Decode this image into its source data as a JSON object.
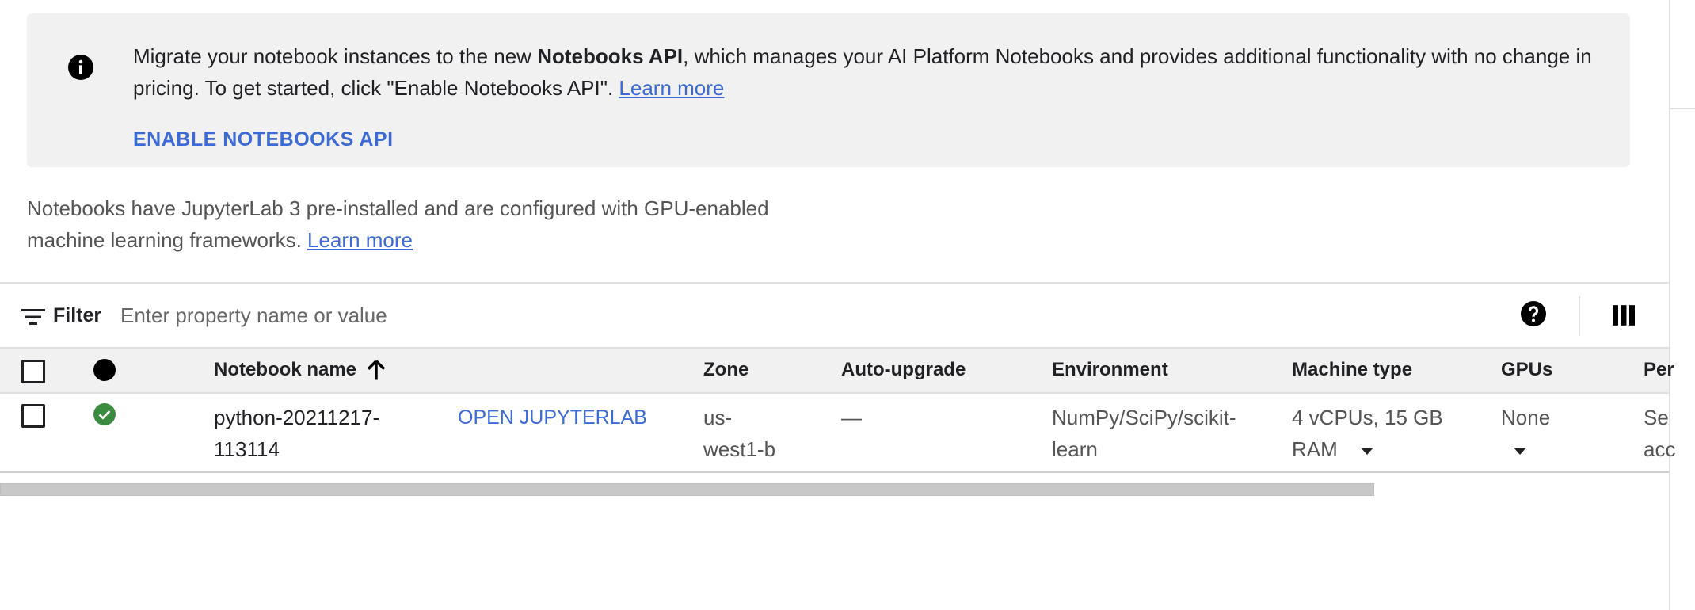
{
  "banner": {
    "message_part1": "Migrate your notebook instances to the new ",
    "message_bold": "Notebooks API",
    "message_part2": ", which manages your AI Platform Notebooks and provides additional functionality with no change in pricing. To get started, click \"Enable Notebooks API\". ",
    "learn_more": "Learn more",
    "enable_button": "ENABLE NOTEBOOKS API"
  },
  "description": {
    "text": "Notebooks have JupyterLab 3 pre-installed and are configured with GPU-enabled machine learning frameworks. ",
    "learn_more": "Learn more"
  },
  "filter": {
    "label": "Filter",
    "placeholder": "Enter property name or value"
  },
  "table": {
    "headers": {
      "notebook_name": "Notebook name",
      "zone": "Zone",
      "auto_upgrade": "Auto-upgrade",
      "environment": "Environment",
      "machine_type": "Machine type",
      "gpus": "GPUs",
      "permission": "Per"
    },
    "rows": [
      {
        "name_line1": "python-20211217-",
        "name_line2": "113114",
        "open_label": "OPEN JUPYTERLAB",
        "zone_line1": "us-",
        "zone_line2": "west1-b",
        "auto_upgrade": "—",
        "environment_line1": "NumPy/SciPy/scikit-",
        "environment_line2": "learn",
        "machine_line1": "4 vCPUs, 15 GB",
        "machine_line2": "RAM",
        "gpus": "None",
        "permission_line1": "Se",
        "permission_line2": "acc",
        "status": "running"
      }
    ]
  },
  "icons": {
    "info": "info-icon",
    "filter": "filter-icon",
    "help": "help-icon",
    "columns": "column-display-icon",
    "sort": "arrow-up-icon",
    "status_ok": "check-circle-icon"
  },
  "colors": {
    "link": "#3c6ad6",
    "status_ok": "#3a8a3f",
    "banner_bg": "#f1f1f1"
  }
}
